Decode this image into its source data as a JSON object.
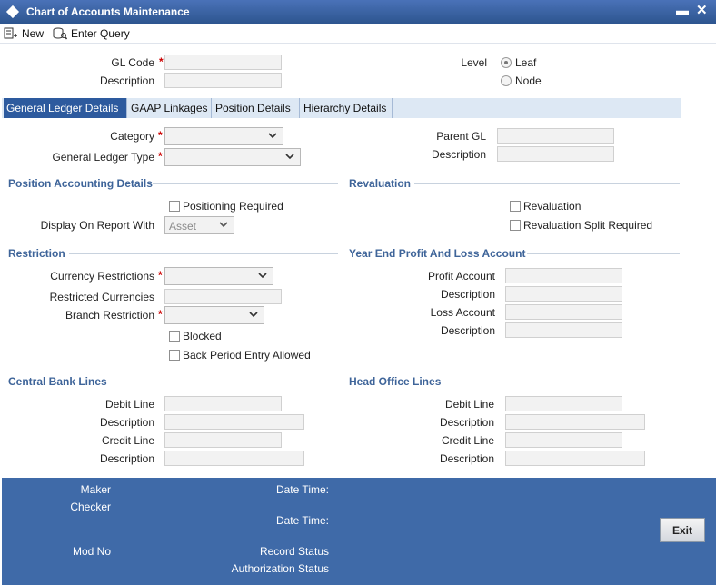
{
  "window": {
    "title": "Chart of Accounts Maintenance",
    "minimize": "▬",
    "close": "✕"
  },
  "toolbar": {
    "new_label": "New",
    "enter_query_label": "Enter Query"
  },
  "header": {
    "gl_code_label": "GL Code",
    "description_label": "Description",
    "level_label": "Level",
    "level_options": [
      "Leaf",
      "Node"
    ],
    "level_selected": "Leaf",
    "required_mark": "*"
  },
  "tabs": [
    "General Ledger Details",
    "GAAP Linkages",
    "Position Details",
    "Hierarchy Details"
  ],
  "general": {
    "category_label": "Category",
    "gl_type_label": "General Ledger Type",
    "parent_gl_label": "Parent GL",
    "parent_desc_label": "Description"
  },
  "position_accounting": {
    "title": "Position Accounting Details",
    "positioning_required_label": "Positioning Required",
    "display_on_report_label": "Display On Report With",
    "display_on_report_value": "Asset"
  },
  "revaluation": {
    "title": "Revaluation",
    "revaluation_label": "Revaluation",
    "split_required_label": "Revaluation Split Required"
  },
  "restriction": {
    "title": "Restriction",
    "currency_restrictions_label": "Currency Restrictions",
    "restricted_currencies_label": "Restricted Currencies",
    "branch_restriction_label": "Branch Restriction",
    "blocked_label": "Blocked",
    "back_period_label": "Back Period Entry Allowed"
  },
  "year_end": {
    "title": "Year End Profit And Loss Account",
    "profit_account_label": "Profit Account",
    "profit_desc_label": "Description",
    "loss_account_label": "Loss Account",
    "loss_desc_label": "Description"
  },
  "central_bank": {
    "title": "Central Bank Lines",
    "debit_line_label": "Debit Line",
    "debit_desc_label": "Description",
    "credit_line_label": "Credit Line",
    "credit_desc_label": "Description"
  },
  "head_office": {
    "title": "Head Office Lines",
    "debit_line_label": "Debit Line",
    "debit_desc_label": "Description",
    "credit_line_label": "Credit Line",
    "credit_desc_label": "Description"
  },
  "footer": {
    "maker_label": "Maker",
    "checker_label": "Checker",
    "date_time_label_1": "Date Time:",
    "date_time_label_2": "Date Time:",
    "mod_no_label": "Mod No",
    "record_status_label": "Record Status",
    "authorization_status_label": "Authorization Status",
    "exit_label": "Exit"
  },
  "colors": {
    "title_bar": "#2d558f",
    "active_tab": "#2d5a9e",
    "section_title": "#3e6499",
    "footer": "#3f6aa8",
    "required": "#cc0000"
  },
  "icons": {
    "title": "diamond-icon",
    "new": "new-record-icon",
    "enter_query": "query-icon",
    "dropdown": "chevron-down-icon"
  }
}
